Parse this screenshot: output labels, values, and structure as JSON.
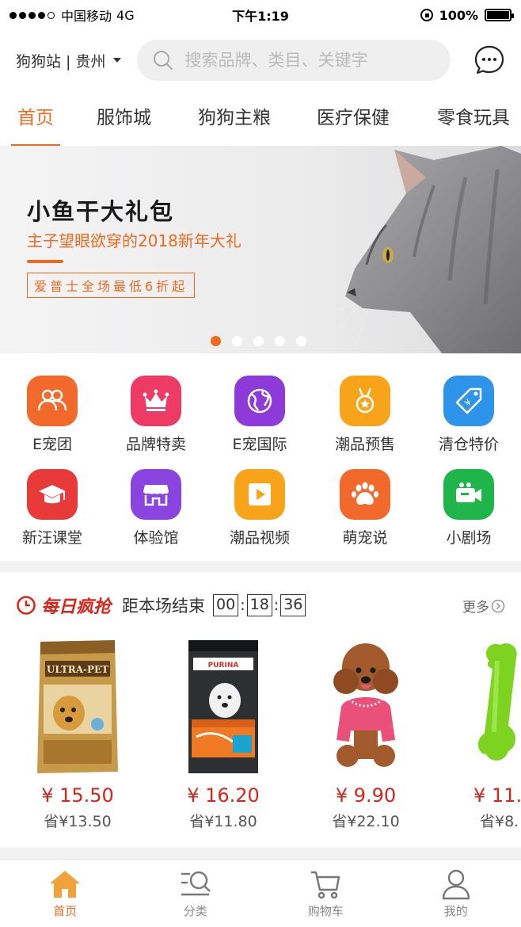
{
  "status_bar": {
    "carrier": "中国移动",
    "network": "4G",
    "time": "下午1:19",
    "battery": "100%"
  },
  "header": {
    "location": "狗狗站 | 贵州",
    "search_placeholder": "搜索品牌、类目、关键字"
  },
  "tabs": [
    {
      "label": "首页",
      "active": true
    },
    {
      "label": "服饰城"
    },
    {
      "label": "狗狗主粮"
    },
    {
      "label": "医疗保健"
    },
    {
      "label": "零食玩具"
    }
  ],
  "banner": {
    "title": "小鱼干大礼包",
    "subtitle": "主子望眼欲穿的2018新年大礼",
    "tag": "爱普士全场最低6折起",
    "page_count": 5,
    "active_page": 1
  },
  "icons": [
    {
      "label": "E宠团",
      "icon": "group-icon",
      "color": "#f26a2b"
    },
    {
      "label": "品牌特卖",
      "icon": "crown-icon",
      "color": "#ee3b65"
    },
    {
      "label": "E宠国际",
      "icon": "globe-icon",
      "color": "#8e3ad8"
    },
    {
      "label": "潮品预售",
      "icon": "medal-icon",
      "color": "#f8a41a"
    },
    {
      "label": "清仓特价",
      "icon": "price-tag-icon",
      "color": "#2e94ea"
    },
    {
      "label": "新汪课堂",
      "icon": "graduation-cap-icon",
      "color": "#e93a3a"
    },
    {
      "label": "体验馆",
      "icon": "store-icon",
      "color": "#8a45e0"
    },
    {
      "label": "潮品视频",
      "icon": "play-icon",
      "color": "#f8a41a"
    },
    {
      "label": "萌宠说",
      "icon": "paw-icon",
      "color": "#f26a2b"
    },
    {
      "label": "小剧场",
      "icon": "video-camera-icon",
      "color": "#20b54a"
    }
  ],
  "flash_sale": {
    "title": "每日疯抢",
    "countdown_label": "距本场结束",
    "hours": "00",
    "minutes": "18",
    "seconds": "36",
    "more": "更多",
    "products": [
      {
        "price": "¥ 15.50",
        "save": "省¥13.50",
        "image": "ultra-pet-dog-food-bag"
      },
      {
        "price": "¥ 16.20",
        "save": "省¥11.80",
        "image": "purina-puppy-food-bag"
      },
      {
        "price": "¥ 9.90",
        "save": "省¥22.10",
        "image": "poodle-in-pink-hoodie"
      },
      {
        "price": "¥ 11.",
        "save": "省¥8.",
        "image": "green-bone-toy"
      }
    ]
  },
  "bottom_nav": [
    {
      "label": "首页",
      "icon": "home-icon",
      "active": true
    },
    {
      "label": "分类",
      "icon": "category-icon"
    },
    {
      "label": "购物车",
      "icon": "cart-icon"
    },
    {
      "label": "我的",
      "icon": "user-icon"
    }
  ],
  "colors": {
    "accent": "#ee6a20",
    "sale_red": "#d9241b"
  }
}
